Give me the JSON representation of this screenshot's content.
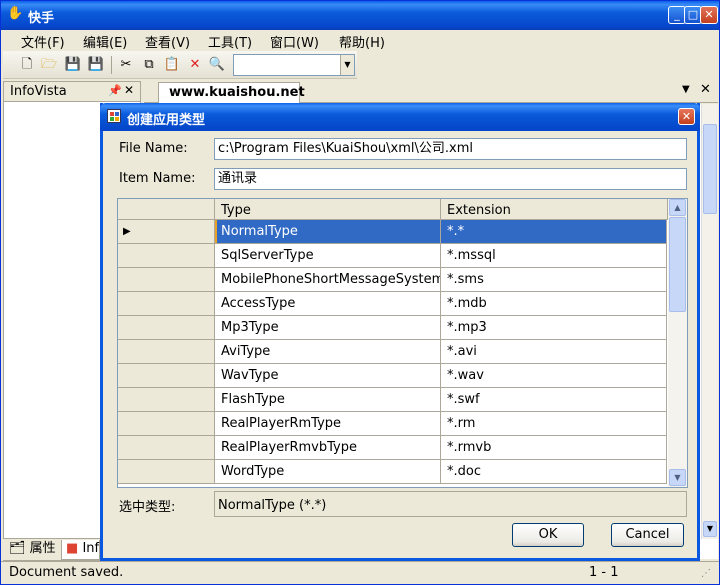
{
  "window": {
    "title": "快手"
  },
  "menu": [
    "文件(F)",
    "编辑(E)",
    "查看(V)",
    "工具(T)",
    "窗口(W)",
    "帮助(H)"
  ],
  "left_panel": {
    "title": "InfoVista",
    "tabs": [
      "属性",
      "Inf"
    ]
  },
  "document": {
    "tab_label": "www.kuaishou.net"
  },
  "status": {
    "message": "Document saved.",
    "position": "1 - 1"
  },
  "dialog": {
    "title": "创建应用类型",
    "file_name_label": "File Name:",
    "file_name_value": "c:\\Program Files\\KuaiShou\\xml\\公司.xml",
    "item_name_label": "Item Name:",
    "item_name_value": "通讯录",
    "grid": {
      "columns": [
        "Type",
        "Extension"
      ],
      "rows": [
        {
          "type": "NormalType",
          "ext": "*.*",
          "selected": true
        },
        {
          "type": "SqlServerType",
          "ext": "*.mssql"
        },
        {
          "type": "MobilePhoneShortMessageSystem",
          "ext": "*.sms"
        },
        {
          "type": "AccessType",
          "ext": "*.mdb"
        },
        {
          "type": "Mp3Type",
          "ext": "*.mp3"
        },
        {
          "type": "AviType",
          "ext": "*.avi"
        },
        {
          "type": "WavType",
          "ext": "*.wav"
        },
        {
          "type": "FlashType",
          "ext": "*.swf"
        },
        {
          "type": "RealPlayerRmType",
          "ext": "*.rm"
        },
        {
          "type": "RealPlayerRmvbType",
          "ext": "*.rmvb"
        },
        {
          "type": "WordType",
          "ext": "*.doc"
        }
      ]
    },
    "selected_label": "选中类型:",
    "selected_value": "NormalType (*.*)",
    "ok_label": "OK",
    "cancel_label": "Cancel"
  }
}
